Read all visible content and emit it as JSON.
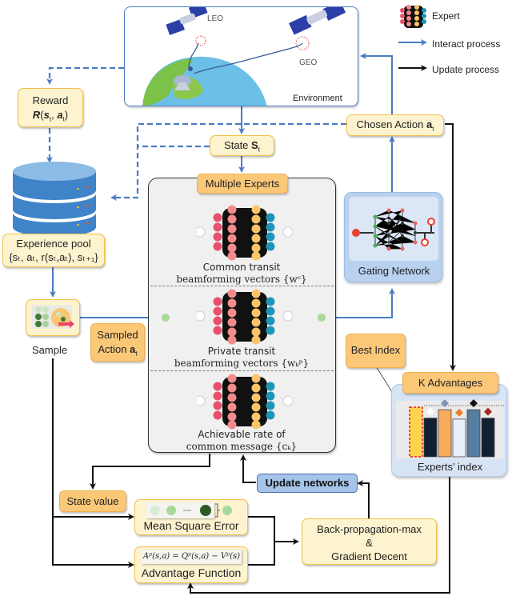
{
  "legend": {
    "expert_label": "Expert",
    "interact_label": "Interact process",
    "update_label": "Update process",
    "interact_color": "#4a7cc4",
    "update_color": "#111111"
  },
  "environment": {
    "label": "Environment",
    "leo_label": "LEO",
    "geo_label": "GEO"
  },
  "reward": {
    "title": "Reward",
    "formula_prefix": "R",
    "formula_args": "(s",
    "sub_t": "t",
    "formula_mid": ", a",
    "formula_end": ")"
  },
  "state": {
    "label": "State ",
    "symbol": "S",
    "sub": "t"
  },
  "chosen_action": {
    "label": "Chosen Action ",
    "symbol": "a",
    "sub": "t"
  },
  "experience_pool": {
    "title": "Experience pool",
    "tuple": "{sₜ, aₜ, r(sₜ,aₜ), sₜ₊₁}"
  },
  "sample": {
    "label": "Sample"
  },
  "sampled_action": {
    "line1": "Sampled",
    "line2": "Action ",
    "symbol": "a",
    "sub": "t"
  },
  "multiple_experts": {
    "title": "Multiple Experts",
    "experts": [
      {
        "caption_line1": "Common transit",
        "caption_line2": "beamforming vectors {wᶜ}"
      },
      {
        "caption_line1": "Private transit",
        "caption_line2": "beamforming vectors {wₖᵖ}"
      },
      {
        "caption_line1": "Achievable rate of",
        "caption_line2": "common message {cₖ}"
      }
    ]
  },
  "gating_network": {
    "label": "Gating Network"
  },
  "best_index": {
    "label": "Best Index"
  },
  "k_advantages": {
    "title": "K Advantages",
    "footer": "Experts’ index",
    "bars": [
      {
        "value": 1.0,
        "color": "#ffd34e",
        "marker": null,
        "highlight": true
      },
      {
        "value": 0.78,
        "color": "#0f2030",
        "marker": "#ffffff"
      },
      {
        "value": 0.95,
        "color": "#f6ac5a",
        "marker": "#7f93b4"
      },
      {
        "value": 0.76,
        "color": "#e8f1fb",
        "marker": "#f07b22"
      },
      {
        "value": 0.95,
        "color": "#557ea0",
        "marker": "#111111"
      },
      {
        "value": 0.78,
        "color": "#0f2030",
        "marker": "#a22a22"
      }
    ]
  },
  "state_value": {
    "label": "State value"
  },
  "mse": {
    "label": "Mean Square Error",
    "dots_ellipsis": "……"
  },
  "advantage": {
    "formula": "Aᵖ(s,a) = Qᵖ(s,a) − Vᵖ(s)",
    "label": "Advantage Function"
  },
  "update_networks": {
    "label": "Update networks"
  },
  "backprop": {
    "line1": "Back-propagation-max",
    "line2": "&",
    "line3": "Gradient Decent"
  }
}
